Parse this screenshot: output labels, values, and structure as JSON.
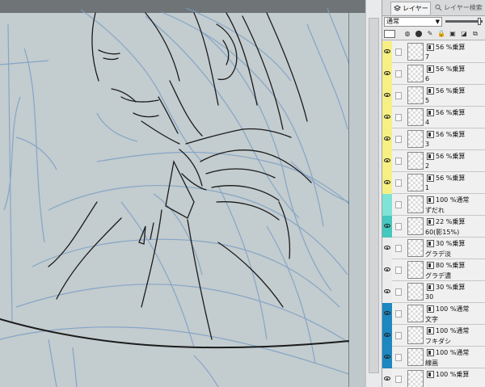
{
  "panel": {
    "tabs": [
      {
        "label": "レイヤー",
        "active": true
      },
      {
        "label": "レイヤー検索",
        "active": false
      }
    ],
    "blend_mode": "通常",
    "opacity_percent": 100
  },
  "layers": [
    {
      "mode": "56 %乗算",
      "name": "7",
      "color": "#f6f084",
      "visible": true
    },
    {
      "mode": "56 %乗算",
      "name": "6",
      "color": "#f6f084",
      "visible": true
    },
    {
      "mode": "56 %乗算",
      "name": "5",
      "color": "#f6f084",
      "visible": true
    },
    {
      "mode": "56 %乗算",
      "name": "4",
      "color": "#f6f084",
      "visible": true
    },
    {
      "mode": "56 %乗算",
      "name": "3",
      "color": "#f6f084",
      "visible": true
    },
    {
      "mode": "56 %乗算",
      "name": "2",
      "color": "#f6f084",
      "visible": true
    },
    {
      "mode": "56 %乗算",
      "name": "1",
      "color": "#f6f084",
      "visible": true
    },
    {
      "mode": "100 %通常",
      "name": "ずだれ",
      "color": "#7fe3d6",
      "visible": false
    },
    {
      "mode": "22 %乗算",
      "name": "60(影15%)",
      "color": "#45c8be",
      "visible": true
    },
    {
      "mode": "30 %乗算",
      "name": "グラデ淡",
      "color": "#ececec",
      "visible": true
    },
    {
      "mode": "80 %乗算",
      "name": "グラデ濃",
      "color": "#ececec",
      "visible": true
    },
    {
      "mode": "30 %乗算",
      "name": "30",
      "color": "#ececec",
      "visible": true
    },
    {
      "mode": "100 %通常",
      "name": "文字",
      "color": "#1d87c0",
      "visible": true
    },
    {
      "mode": "100 %通常",
      "name": "フキダシ",
      "color": "#1d87c0",
      "visible": true
    },
    {
      "mode": "100 %通常",
      "name": "線画",
      "color": "#1d87c0",
      "visible": true
    },
    {
      "mode": "100 %乗算",
      "name": "",
      "color": "#ececec",
      "visible": true
    }
  ]
}
